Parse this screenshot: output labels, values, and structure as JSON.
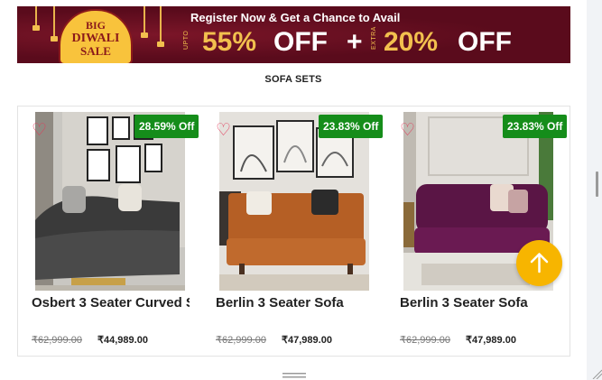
{
  "banner": {
    "badge_line1": "BIG",
    "badge_line2": "DIWALI",
    "badge_line3": "SALE",
    "headline": "Register Now &  Get a Chance to Avail",
    "upto": "UPTO",
    "discount1": "55%",
    "off1": "OFF",
    "plus": "+",
    "extra": "EXTRA",
    "discount2": "20%",
    "off2": "OFF"
  },
  "section": {
    "title": "SOFA SETS"
  },
  "products": [
    {
      "title": "Osbert 3 Seater Curved S",
      "discount": "28.59% Off",
      "mrp": "₹62,999.00",
      "price": "₹44,989.00"
    },
    {
      "title": "Berlin 3 Seater Sofa",
      "discount": "23.83% Off",
      "mrp": "₹62,999.00",
      "price": "₹47,989.00"
    },
    {
      "title": "Berlin 3 Seater Sofa",
      "discount": "23.83% Off",
      "mrp": "₹62,999.00",
      "price": "₹47,989.00"
    }
  ],
  "icons": {
    "wishlist": "heart-outline-icon",
    "scroll_top": "arrow-up-icon"
  },
  "colors": {
    "banner_bg": "#5a0b1c",
    "banner_accent": "#f2c04e",
    "discount_badge": "#158d1a",
    "heart": "#e23a5a",
    "scroll_button": "#f7b500"
  }
}
